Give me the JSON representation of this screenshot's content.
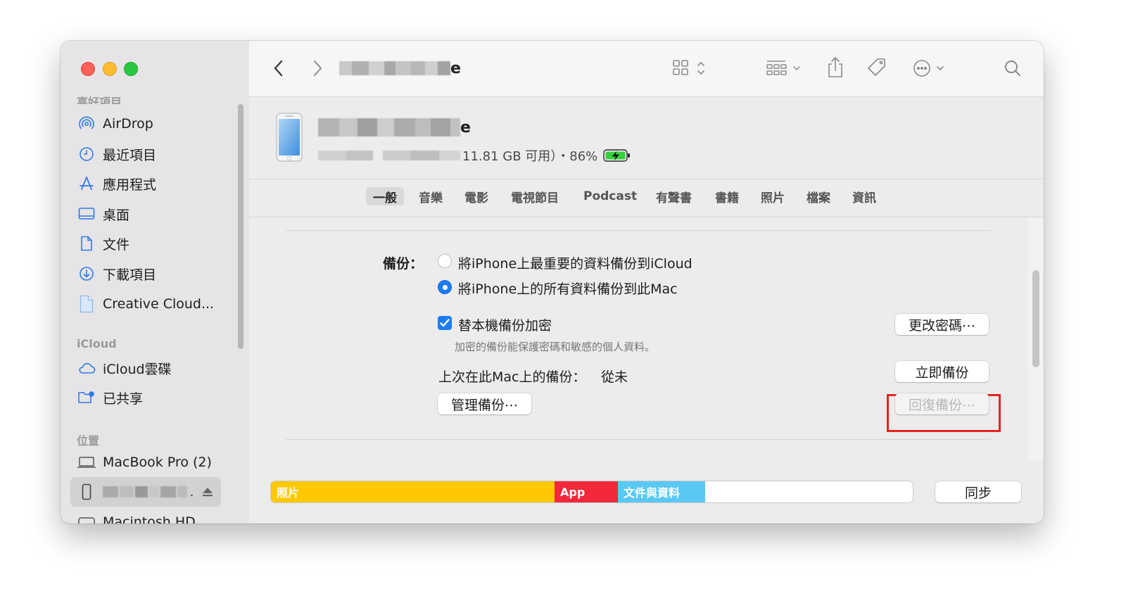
{
  "sidebar": {
    "favorites_title": "喜好項目",
    "items": [
      {
        "label": "AirDrop",
        "icon": "airdrop-icon"
      },
      {
        "label": "最近項目",
        "icon": "recents-clock-icon"
      },
      {
        "label": "應用程式",
        "icon": "applications-icon"
      },
      {
        "label": "桌面",
        "icon": "desktop-icon"
      },
      {
        "label": "文件",
        "icon": "document-icon"
      },
      {
        "label": "下載項目",
        "icon": "download-icon"
      },
      {
        "label": "Creative Cloud...",
        "icon": "file-icon"
      }
    ],
    "icloud_title": "iCloud",
    "icloud_items": [
      {
        "label": "iCloud雲碟",
        "icon": "cloud-icon"
      },
      {
        "label": "已共享",
        "icon": "shared-folder-icon"
      }
    ],
    "locations_title": "位置",
    "location_items": [
      {
        "label": "MacBook Pro (2)",
        "icon": "laptop-icon"
      },
      {
        "label": "Macintosh HD",
        "icon": "disk-icon"
      }
    ],
    "device_label_suffix": "."
  },
  "toolbar": {
    "title_suffix": "e"
  },
  "device": {
    "name_suffix": "e",
    "storage_info": "11.81 GB 可用）・86%"
  },
  "tabs": [
    "一般",
    "音樂",
    "電影",
    "電視節目",
    "Podcast",
    "有聲書",
    "書籍",
    "照片",
    "檔案",
    "資訊"
  ],
  "active_tab": "一般",
  "backup": {
    "label": "備份：",
    "option_icloud": "將iPhone上最重要的資料備份到iCloud",
    "option_mac": "將iPhone上的所有資料備份到此Mac",
    "selected_option": "mac",
    "encrypt_label": "替本機備份加密",
    "encrypt_checked": true,
    "encrypt_hint": "加密的備份能保護密碼和敏感的個人資料。",
    "last_backup_label": "上次在此Mac上的備份：",
    "last_backup_value": "從未",
    "change_password_button": "更改密碼⋯",
    "backup_now_button": "立即備份",
    "manage_button": "管理備份⋯",
    "restore_button": "回復備份⋯"
  },
  "storage_bar": {
    "segments": [
      {
        "label": "照片",
        "color": "#ffc800"
      },
      {
        "label": "App",
        "color": "#f2293b"
      },
      {
        "label": "文件與資料",
        "color": "#5ac8f5"
      }
    ],
    "sync_button": "同步"
  },
  "colors": {
    "accent": "#1b7cf5",
    "highlight_box": "#e8241c",
    "battery": "#37d03c"
  }
}
